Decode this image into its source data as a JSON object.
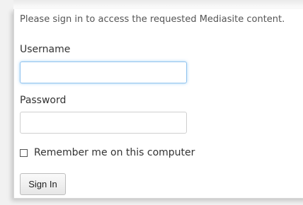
{
  "form": {
    "intro": "Please sign in to access the requested Mediasite content.",
    "username_label": "Username",
    "username_value": "",
    "password_label": "Password",
    "password_value": "",
    "remember_label": "Remember me on this computer",
    "remember_checked": false,
    "signin_label": "Sign In"
  }
}
